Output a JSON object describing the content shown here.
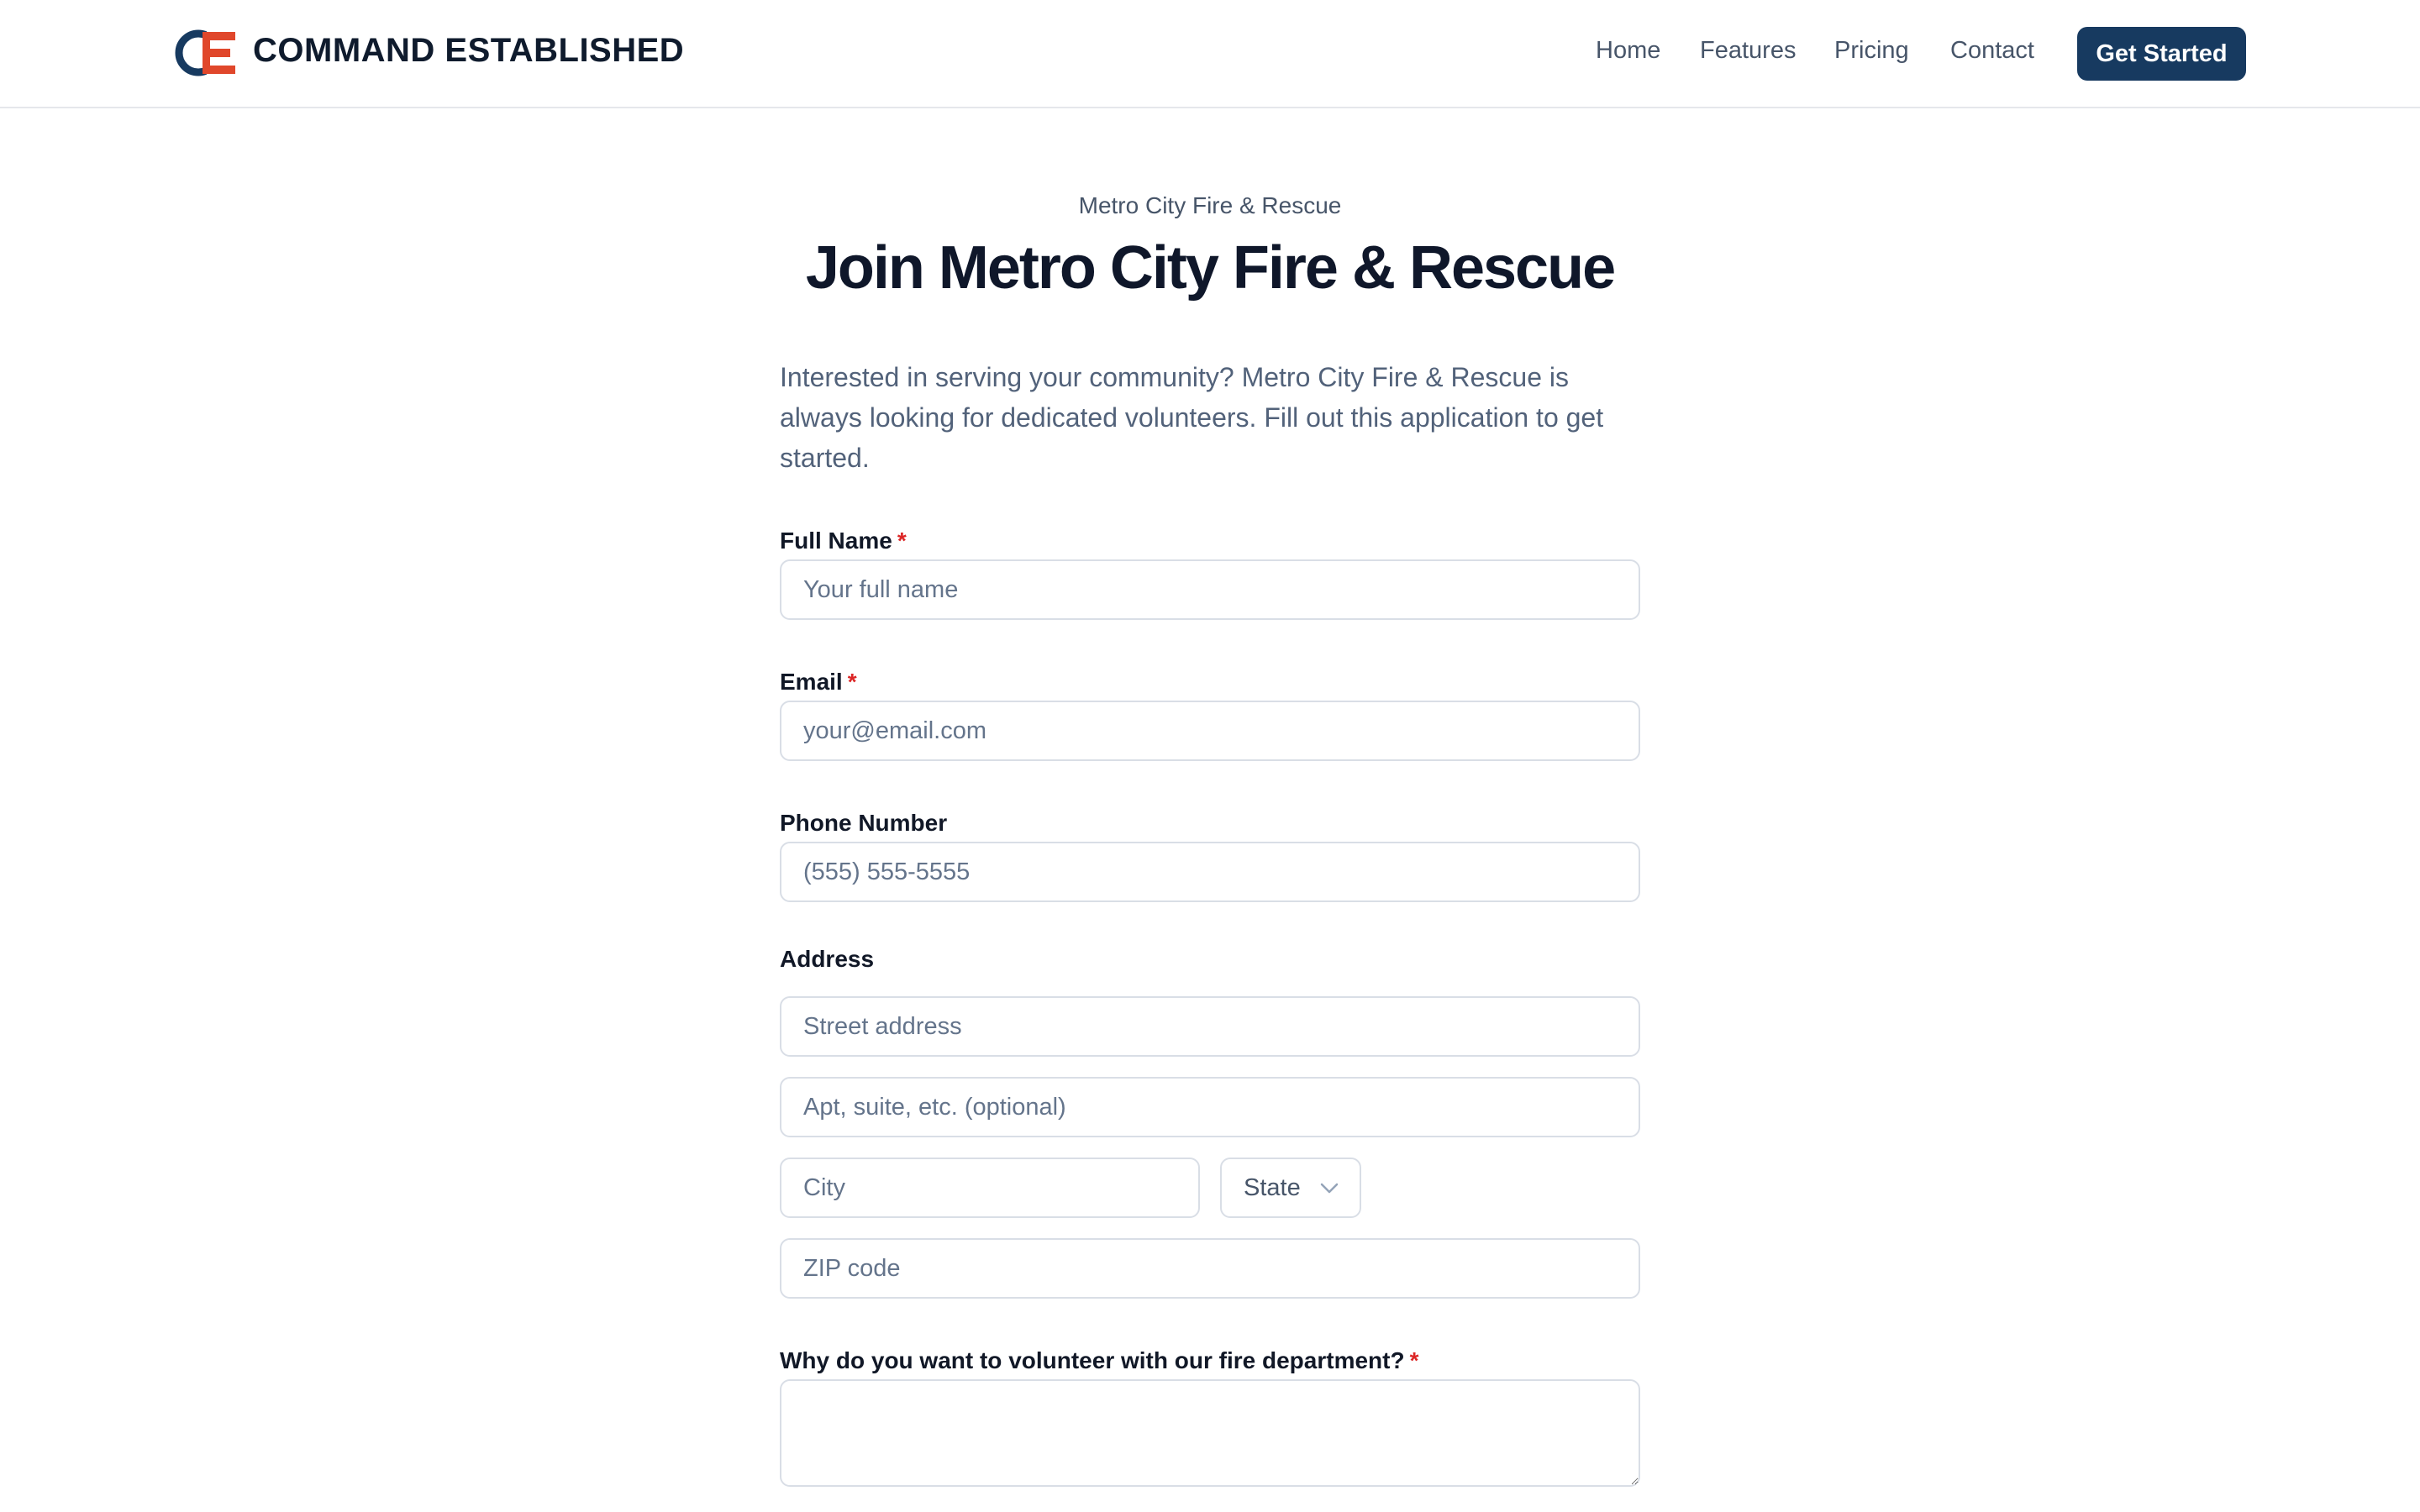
{
  "header": {
    "brand": "COMMAND ESTABLISHED",
    "nav": [
      "Home",
      "Features",
      "Pricing",
      "Contact"
    ],
    "cta": "Get Started"
  },
  "hero": {
    "eyebrow": "Metro City Fire & Rescue",
    "title": "Join Metro City Fire & Rescue",
    "intro": "Interested in serving your community? Metro City Fire & Rescue is always looking for dedicated volunteers. Fill out this application to get started."
  },
  "form": {
    "full_name": {
      "label": "Full Name",
      "required_mark": "*",
      "placeholder": "Your full name",
      "value": ""
    },
    "email": {
      "label": "Email",
      "required_mark": "*",
      "placeholder": "your@email.com",
      "value": ""
    },
    "phone": {
      "label": "Phone Number",
      "placeholder": "(555) 555-5555",
      "value": ""
    },
    "address": {
      "label": "Address",
      "street_placeholder": "Street address",
      "apt_placeholder": "Apt, suite, etc. (optional)",
      "city_placeholder": "City",
      "state_selected": "State",
      "zip_placeholder": "ZIP code"
    },
    "why": {
      "label": "Why do you want to volunteer with our fire department?",
      "required_mark": "*",
      "value": ""
    }
  },
  "colors": {
    "brand_navy": "#173a60",
    "logo_red": "#e0472b",
    "required_red": "#dc2626",
    "muted_text": "#52627a"
  },
  "icons": {
    "logo": "ce-logo-icon",
    "select": "chevron-down-icon"
  }
}
